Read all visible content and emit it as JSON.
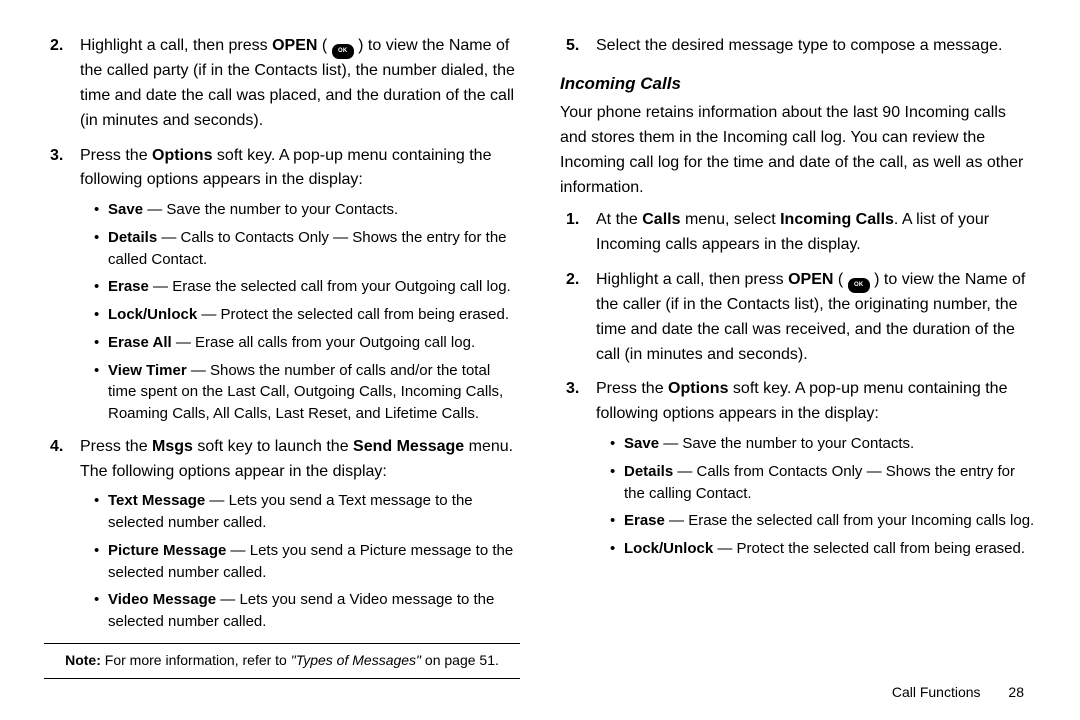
{
  "footer": {
    "section": "Call Functions",
    "page": "28"
  },
  "ok_label": "OK",
  "left": {
    "items": [
      {
        "num": "2.",
        "pre": "Highlight a call, then press ",
        "open": "OPEN",
        "post": " to view the Name of the called party (if in the Contacts list), the number dialed, the time and date the call was placed, and the duration of the call (in minutes and seconds)."
      },
      {
        "num": "3.",
        "pre": "Press the ",
        "options": "Options",
        "post": " soft key. A pop-up menu containing the following options appears in the display:",
        "bullets": [
          {
            "label": "Save",
            "text": " — Save the number to your Contacts."
          },
          {
            "label": "Details",
            "text": " — Calls to Contacts Only — Shows the entry for the called Contact."
          },
          {
            "label": "Erase",
            "text": " — Erase the selected call from your Outgoing call log."
          },
          {
            "label": "Lock/Unlock",
            "text": " — Protect the selected call from being erased."
          },
          {
            "label": "Erase All",
            "text": " — Erase all calls from your Outgoing call log."
          },
          {
            "label": "View Timer",
            "text": " — Shows the number of calls and/or the total time spent on the Last Call, Outgoing Calls, Incoming Calls, Roaming Calls, All Calls, Last Reset, and Lifetime Calls."
          }
        ]
      },
      {
        "num": "4.",
        "pre": "Press the ",
        "msgs": "Msgs",
        "mid": " soft key to launch the ",
        "send": "Send Message",
        "post": " menu. The following options appear in the display:",
        "bullets": [
          {
            "label": "Text Message",
            "text": " — Lets you send a Text message to the selected number called."
          },
          {
            "label": "Picture Message",
            "text": " — Lets you send a Picture message to the selected number called."
          },
          {
            "label": "Video Message",
            "text": " — Lets you send a Video message to the selected number called."
          }
        ]
      }
    ]
  },
  "note": {
    "label": "Note:",
    "text": " For more information, refer to ",
    "ref": "\"Types of Messages\"",
    "tail": "  on page 51."
  },
  "step5": {
    "num": "5.",
    "text": "Select the desired message type to compose a message."
  },
  "incoming": {
    "heading": "Incoming Calls",
    "intro": "Your phone retains information about the last 90 Incoming calls and stores them in the Incoming call log. You can review the Incoming call log for the time and date of the call, as well as other information.",
    "items": [
      {
        "num": "1.",
        "pre": "At the ",
        "calls": "Calls",
        "mid": " menu, select ",
        "incoming": "Incoming Calls",
        "post": ". A list of your Incoming calls appears in the display."
      },
      {
        "num": "2.",
        "pre": "Highlight a call, then press ",
        "open": "OPEN",
        "post": " to view the Name of the caller (if in the Contacts list), the originating number, the time and date the call was received, and the duration of the call (in minutes and seconds)."
      },
      {
        "num": "3.",
        "pre": "Press the ",
        "options": "Options",
        "post": " soft key. A pop-up menu containing the following options appears in the display:",
        "bullets": [
          {
            "label": "Save",
            "text": " — Save the number to your Contacts."
          },
          {
            "label": "Details",
            "text": " — Calls from Contacts Only — Shows the entry for the calling Contact."
          },
          {
            "label": "Erase",
            "text": " — Erase the selected call from your Incoming calls log."
          },
          {
            "label": "Lock/Unlock",
            "text": " — Protect the selected call from being erased."
          }
        ]
      }
    ]
  }
}
